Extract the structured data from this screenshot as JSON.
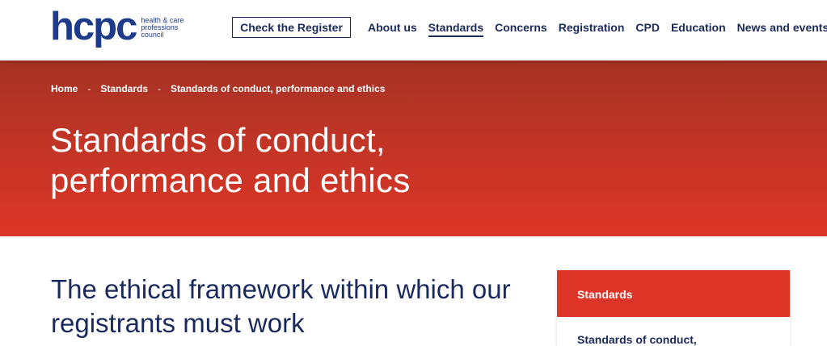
{
  "logo": {
    "mark": "hcpc",
    "line1": "health & care",
    "line2": "professions",
    "line3": "council"
  },
  "header": {
    "check_register_label": "Check the Register",
    "nav": [
      {
        "label": "About us",
        "active": false
      },
      {
        "label": "Standards",
        "active": true
      },
      {
        "label": "Concerns",
        "active": false
      },
      {
        "label": "Registration",
        "active": false
      },
      {
        "label": "CPD",
        "active": false
      },
      {
        "label": "Education",
        "active": false
      },
      {
        "label": "News and events",
        "active": false
      }
    ]
  },
  "breadcrumb": {
    "items": [
      "Home",
      "Standards",
      "Standards of conduct, performance and ethics"
    ],
    "separator": "-"
  },
  "hero": {
    "title": "Standards of conduct, performance and ethics"
  },
  "main": {
    "heading": "The ethical framework within which our registrants must work"
  },
  "side_panel": {
    "header": "Standards",
    "link": "Standards of conduct,"
  },
  "colors": {
    "navy": "#1b2a5c",
    "logo_blue": "#1e3a8a",
    "red": "#dc3527",
    "dark_red": "#a43224"
  }
}
